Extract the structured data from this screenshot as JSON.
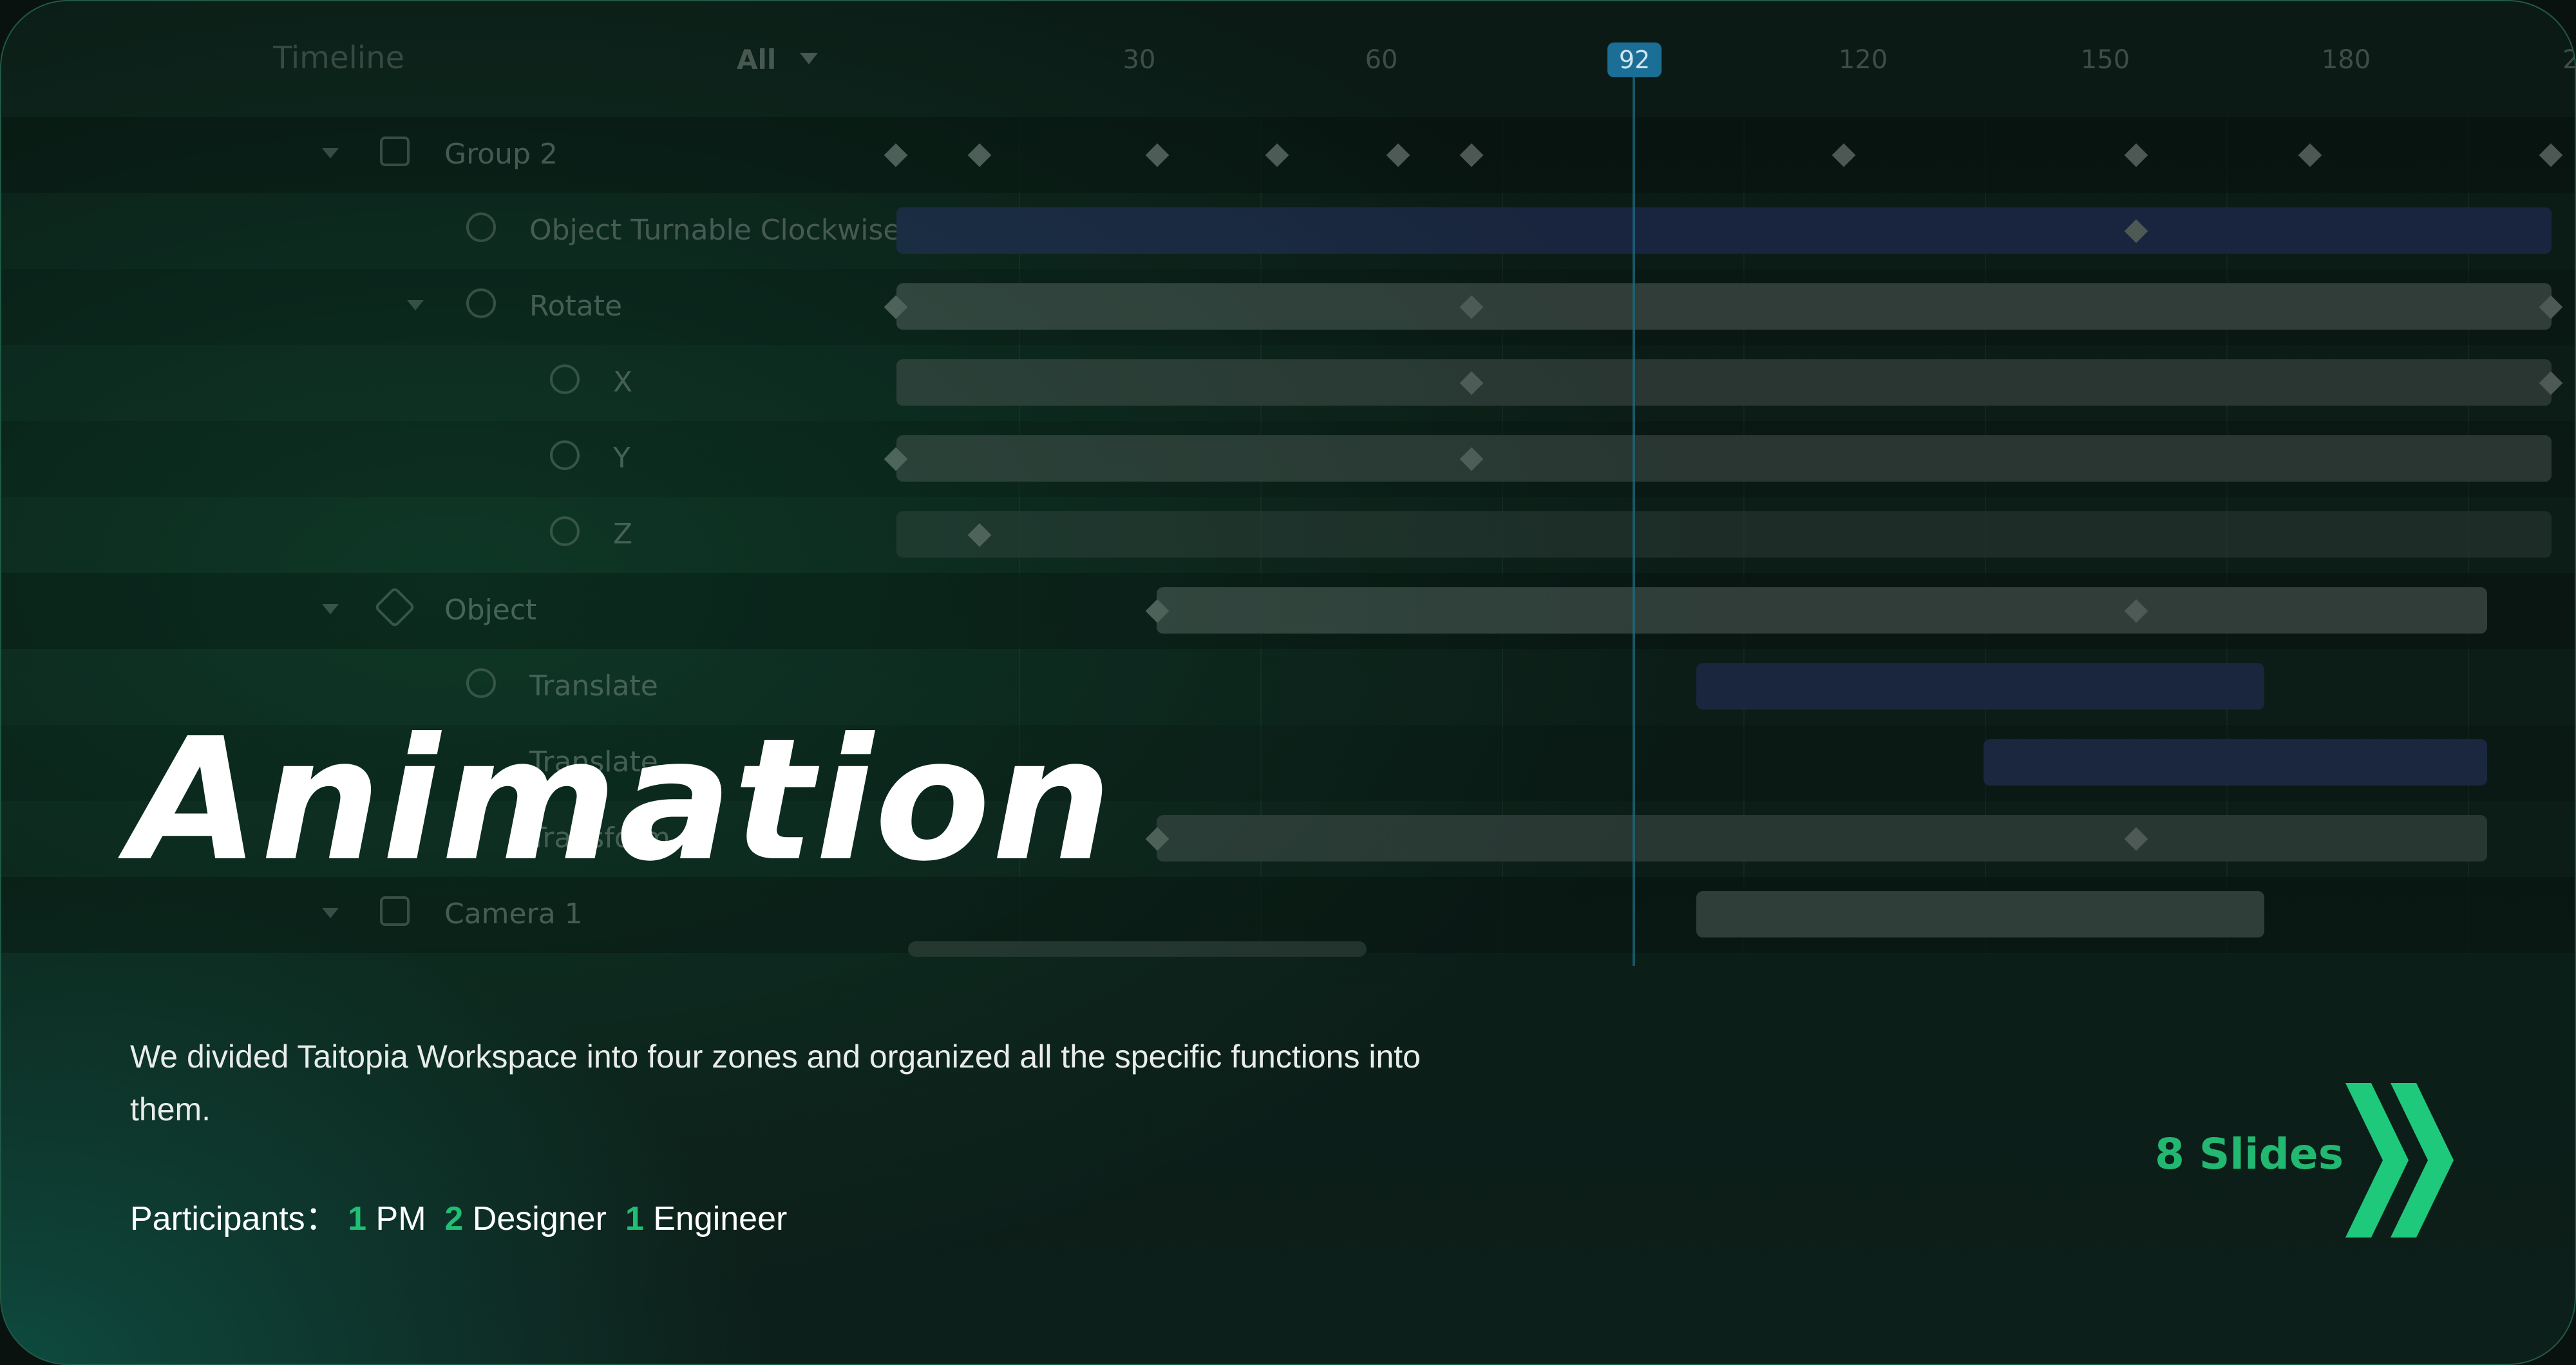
{
  "timeline": {
    "title": "Timeline",
    "filter": "All",
    "ticks": [
      "30",
      "60",
      "120",
      "150",
      "180",
      "2"
    ],
    "playhead": "92",
    "rows": [
      "Group 2",
      "Object Turnable Clockwise",
      "Rotate",
      "X",
      "Y",
      "Z",
      "Object",
      "Translate",
      "Translate",
      "Transform",
      "Camera 1"
    ]
  },
  "hero": {
    "title": "Animation",
    "description": "We divided Taitopia Workspace into four zones and organized all the specific functions into them.",
    "participants_label": "Participants：",
    "pm_count": "1",
    "pm_label": "PM",
    "designer_count": "2",
    "designer_label": "Designer",
    "engineer_count": "1",
    "engineer_label": "Engineer"
  },
  "cta": {
    "label": "8 Slides",
    "icon": "double-chevron-right-icon"
  },
  "colors": {
    "accent": "#22b871",
    "playhead": "#1b6f97",
    "blue_bar": "#3a3f9a"
  }
}
